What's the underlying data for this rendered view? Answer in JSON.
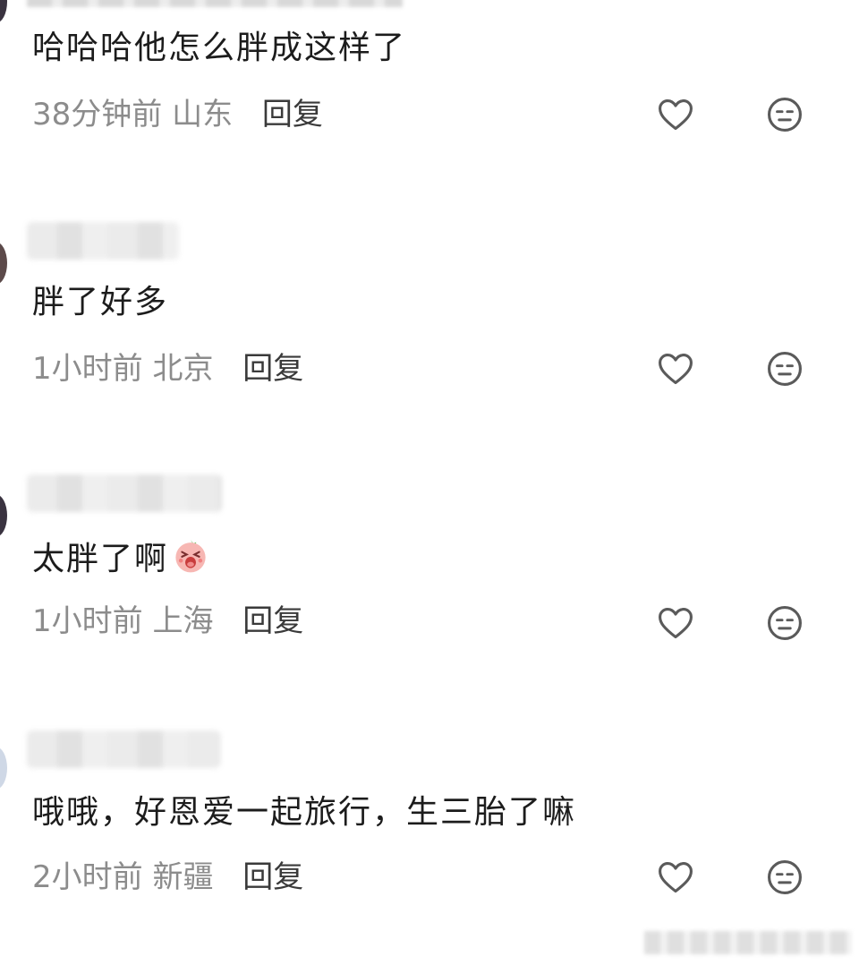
{
  "comments": [
    {
      "text": "哈哈哈他怎么胖成这样了",
      "time": "38分钟前",
      "location": "山东",
      "reply": "回复"
    },
    {
      "text": "胖了好多",
      "time": "1小时前",
      "location": "北京",
      "reply": "回复"
    },
    {
      "text": "太胖了啊",
      "time": "1小时前",
      "location": "上海",
      "reply": "回复",
      "emoji": "shocked-face-emoji"
    },
    {
      "text": "哦哦，好恩爱一起旅行，生三胎了嘛",
      "time": "2小时前",
      "location": "新疆",
      "reply": "回复"
    }
  ],
  "icons": {
    "like": "heart-outline-icon",
    "dislike": "neutral-face-icon"
  },
  "colors": {
    "text": "#1c1c1c",
    "meta": "#8c8c8c",
    "reply": "#3a3a3a",
    "icon": "#5a5a5a"
  }
}
